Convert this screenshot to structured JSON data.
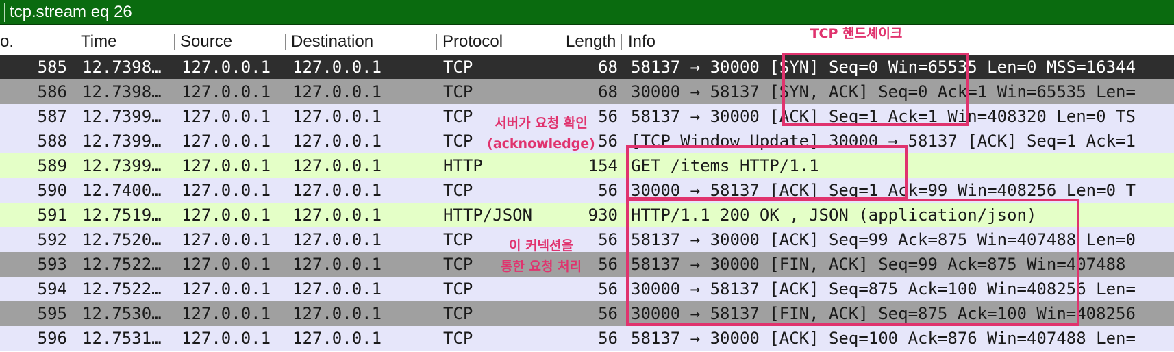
{
  "filter": {
    "text": "tcp.stream eq 26"
  },
  "columns": [
    "o.",
    "Time",
    "Source",
    "Destination",
    "Protocol",
    "Length",
    "Info"
  ],
  "colors": {
    "filter_bg": "#0a6b0f",
    "row_tcp_selected": "#2e2e2e",
    "row_tcp_lavender": "#e6e6fa",
    "row_tcp_grey": "#a0a0a0",
    "row_http": "#e4ffc7",
    "annotation": "#e0336e"
  },
  "packets": [
    {
      "no": "585",
      "time": "12.7398…",
      "source": "127.0.0.1",
      "destination": "127.0.0.1",
      "protocol": "TCP",
      "length": "68",
      "info": "58137 → 30000 [SYN] Seq=0 Win=65535 Len=0 MSS=16344",
      "color": "#2e2e2e",
      "selected": true
    },
    {
      "no": "586",
      "time": "12.7398…",
      "source": "127.0.0.1",
      "destination": "127.0.0.1",
      "protocol": "TCP",
      "length": "68",
      "info": "30000 → 58137 [SYN, ACK] Seq=0 Ack=1 Win=65535 Len=",
      "color": "#a0a0a0",
      "selected": false
    },
    {
      "no": "587",
      "time": "12.7399…",
      "source": "127.0.0.1",
      "destination": "127.0.0.1",
      "protocol": "TCP",
      "length": "56",
      "info": "58137 → 30000 [ACK] Seq=1 Ack=1 Win=408320 Len=0 TS",
      "color": "#e6e6fa",
      "selected": false
    },
    {
      "no": "588",
      "time": "12.7399…",
      "source": "127.0.0.1",
      "destination": "127.0.0.1",
      "protocol": "TCP",
      "length": "56",
      "info": "[TCP Window Update] 30000 → 58137 [ACK] Seq=1 Ack=1",
      "color": "#e6e6fa",
      "selected": false
    },
    {
      "no": "589",
      "time": "12.7399…",
      "source": "127.0.0.1",
      "destination": "127.0.0.1",
      "protocol": "HTTP",
      "length": "154",
      "info": "GET /items HTTP/1.1",
      "color": "#e4ffc7",
      "selected": false
    },
    {
      "no": "590",
      "time": "12.7400…",
      "source": "127.0.0.1",
      "destination": "127.0.0.1",
      "protocol": "TCP",
      "length": "56",
      "info": "30000 → 58137 [ACK] Seq=1 Ack=99 Win=408256 Len=0 T",
      "color": "#e6e6fa",
      "selected": false
    },
    {
      "no": "591",
      "time": "12.7519…",
      "source": "127.0.0.1",
      "destination": "127.0.0.1",
      "protocol": "HTTP/JSON",
      "length": "930",
      "info": "HTTP/1.1 200 OK , JSON (application/json)",
      "color": "#e4ffc7",
      "selected": false
    },
    {
      "no": "592",
      "time": "12.7520…",
      "source": "127.0.0.1",
      "destination": "127.0.0.1",
      "protocol": "TCP",
      "length": "56",
      "info": "58137 → 30000 [ACK] Seq=99 Ack=875 Win=407488 Len=0",
      "color": "#e6e6fa",
      "selected": false
    },
    {
      "no": "593",
      "time": "12.7522…",
      "source": "127.0.0.1",
      "destination": "127.0.0.1",
      "protocol": "TCP",
      "length": "56",
      "info": "58137 → 30000 [FIN, ACK] Seq=99 Ack=875 Win=407488",
      "color": "#a0a0a0",
      "selected": false
    },
    {
      "no": "594",
      "time": "12.7522…",
      "source": "127.0.0.1",
      "destination": "127.0.0.1",
      "protocol": "TCP",
      "length": "56",
      "info": "30000 → 58137 [ACK] Seq=875 Ack=100 Win=408256 Len=",
      "color": "#e6e6fa",
      "selected": false
    },
    {
      "no": "595",
      "time": "12.7530…",
      "source": "127.0.0.1",
      "destination": "127.0.0.1",
      "protocol": "TCP",
      "length": "56",
      "info": "30000 → 58137 [FIN, ACK] Seq=875 Ack=100 Win=408256",
      "color": "#a0a0a0",
      "selected": false
    },
    {
      "no": "596",
      "time": "12.7531…",
      "source": "127.0.0.1",
      "destination": "127.0.0.1",
      "protocol": "TCP",
      "length": "56",
      "info": "58137 → 30000 [ACK] Seq=100 Ack=876 Win=407488 Len=",
      "color": "#e6e6fa",
      "selected": false
    }
  ],
  "annotations": {
    "handshake": "TCP 핸드셰이크",
    "ack_line1": "서버가 요청 확인",
    "ack_line2": "(acknowledge)",
    "conn_line1": "이 커넥션을",
    "conn_line2": "통한 요청 처리"
  }
}
